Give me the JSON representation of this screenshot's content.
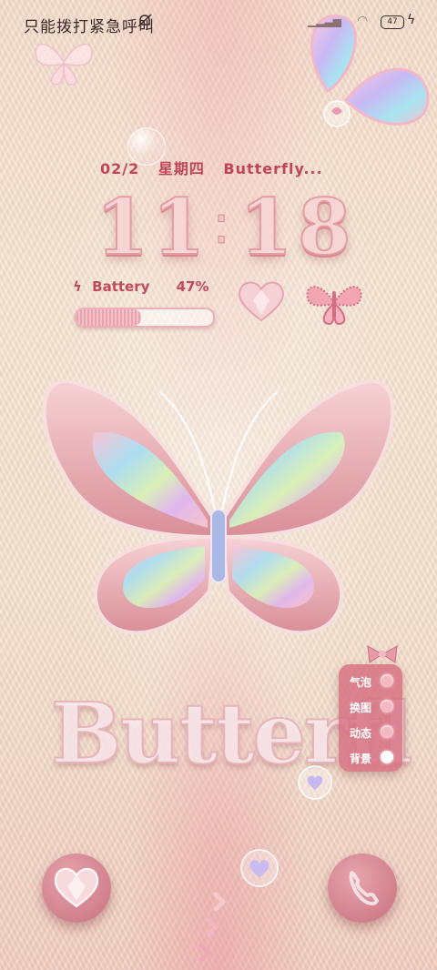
{
  "status_bar": {
    "carrier_text": "只能拨打紧急呼叫",
    "battery_level": "47"
  },
  "date_line": {
    "date": "02/2",
    "weekday": "星期四",
    "title": "Butterfly..."
  },
  "clock": {
    "h1": "1",
    "h2": "1",
    "m1": "1",
    "m2": "8"
  },
  "battery_widget": {
    "label": "Battery",
    "percent": "47%",
    "level": 0.47
  },
  "hero_word": "Butterfl",
  "side_menu": {
    "items": [
      {
        "label": "气泡",
        "active": false
      },
      {
        "label": "换图",
        "active": false
      },
      {
        "label": "动态",
        "active": false
      },
      {
        "label": "背景",
        "active": true
      }
    ]
  },
  "colors": {
    "accent": "#c0455a",
    "menu_bg": "#d66e80",
    "fur": "#f3e2d0"
  },
  "icons": {
    "bottom_left": "heart-gem-icon",
    "bottom_right": "phone-icon",
    "bottom_center": "heart-bubble-icon"
  }
}
